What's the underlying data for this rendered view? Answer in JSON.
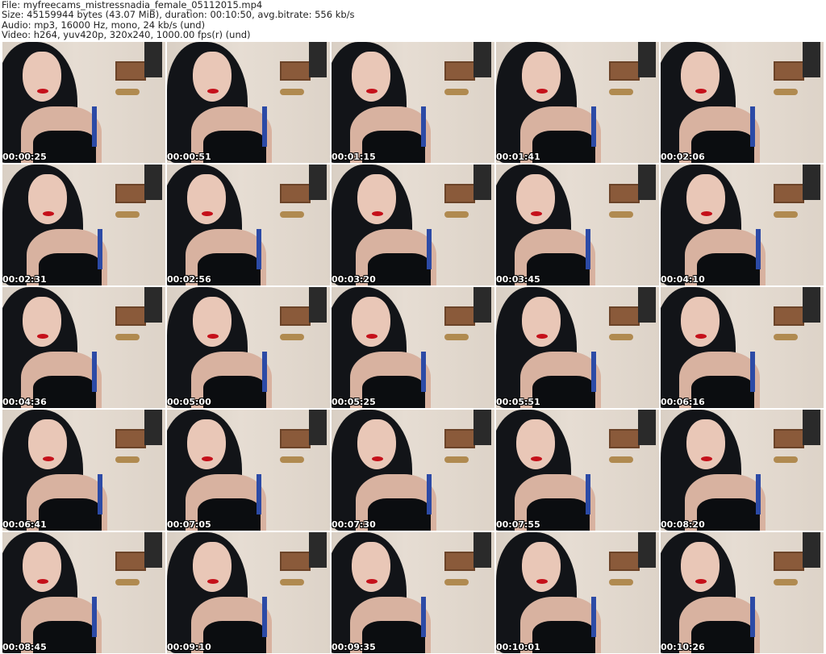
{
  "header": {
    "file": "File: myfreecams_mistressnadia_female_05112015.mp4",
    "size": "Size: 45159944 bytes (43.07 MiB), duration: 00:10:50, avg.bitrate: 556 kb/s",
    "audio": "Audio: mp3, 16000 Hz, mono, 24 kb/s (und)",
    "video": "Video: h264, yuv420p, 320x240, 1000.00 fps(r) (und)"
  },
  "thumbnails": [
    "00:00:25",
    "00:00:51",
    "00:01:15",
    "00:01:41",
    "00:02:06",
    "00:02:31",
    "00:02:56",
    "00:03:20",
    "00:03:45",
    "00:04:10",
    "00:04:36",
    "00:05:00",
    "00:05:25",
    "00:05:51",
    "00:06:16",
    "00:06:41",
    "00:07:05",
    "00:07:30",
    "00:07:55",
    "00:08:20",
    "00:08:45",
    "00:09:10",
    "00:09:35",
    "00:10:01",
    "00:10:26"
  ]
}
